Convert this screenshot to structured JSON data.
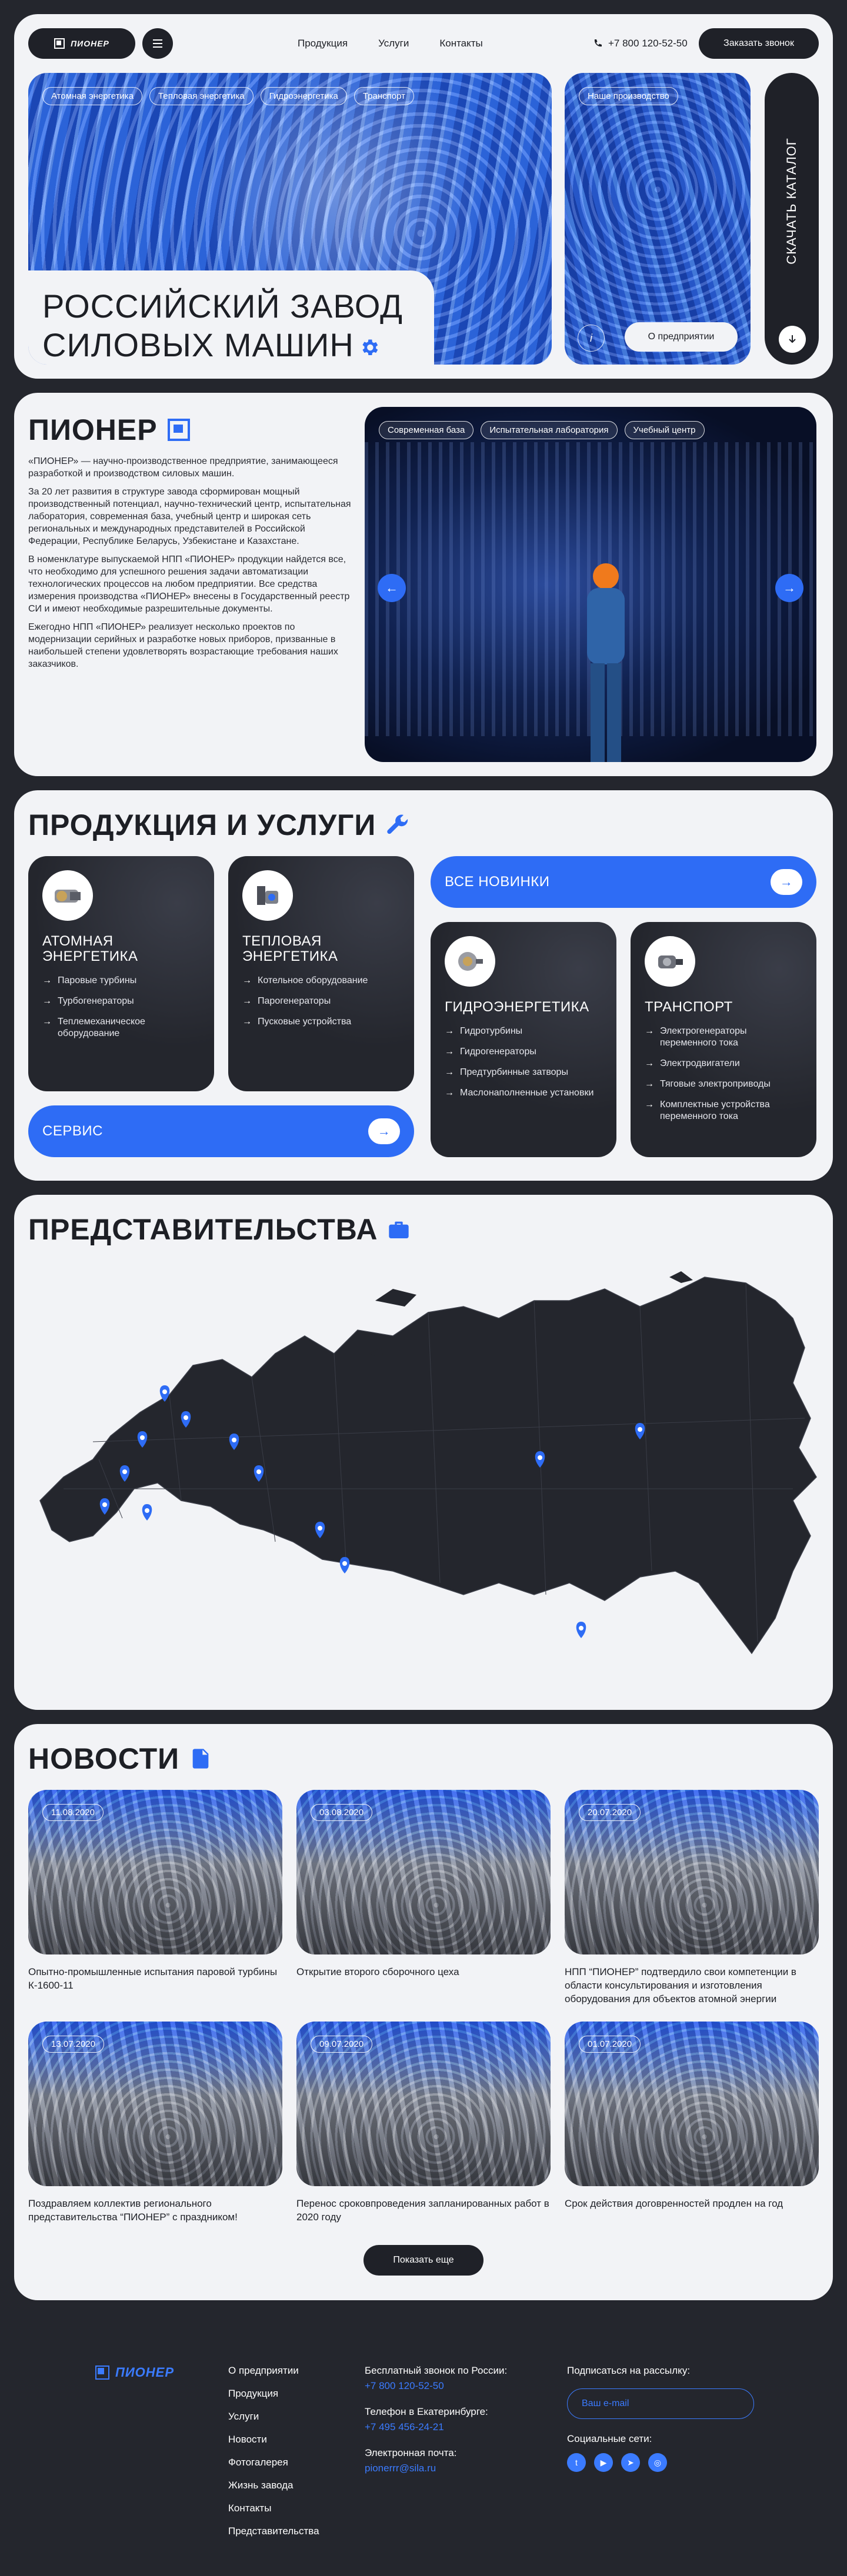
{
  "header": {
    "logo": "ПИОНЕР",
    "nav": [
      "Продукция",
      "Услуги",
      "Контакты"
    ],
    "phone": "+7 800 120-52-50",
    "call_button": "Заказать звонок"
  },
  "hero": {
    "tags": [
      "Атомная энергетика",
      "Тепловая энергетика",
      "Гидроэнергетика",
      "Транспорт"
    ],
    "title": "РОССИЙСКИЙ ЗАВОД\nСИЛОВЫХ МАШИН",
    "side_tag": "Наше производство",
    "about_button": "О предприятии",
    "catalog_button": "СКАЧАТЬ КАТАЛОГ",
    "info_icon": "i"
  },
  "about": {
    "title": "ПИОНЕР",
    "paragraphs": [
      "«ПИОНЕР» — научно-производственное предприятие, занимающееся разработкой и производством силовых машин.",
      "За 20 лет развития в структуре завода сформирован мощный производственный потенциал, научно-технический центр, испытательная лаборатория, современная база, учебный центр и широкая сеть региональных и международных представителей в Российской Федерации, Республике Беларусь, Узбекистане и Казахстане.",
      "В номенклатуре выпускаемой НПП «ПИОНЕР» продукции найдется все, что необходимо для успешного решения задачи автоматизации технологических процессов на любом предприятии. Все средства измерения производства «ПИОНЕР» внесены в Государственный реестр СИ и имеют необходимые разрешительные документы.",
      "Ежегодно НПП «ПИОНЕР» реализует несколько проектов по модернизации серийных и разработке новых приборов, призванные в наибольшей степени удовлетворять возрастающие требования наших заказчиков."
    ],
    "photo_tags": [
      "Современная база",
      "Испытательная лаборатория",
      "Учебный центр"
    ],
    "prev": "←",
    "next": "→"
  },
  "products": {
    "title": "ПРОДУКЦИЯ И УСЛУГИ",
    "all_new": "ВСЕ НОВИНКИ",
    "service": "СЕРВИС",
    "arrow": "→",
    "cards": [
      {
        "title": "АТОМНАЯ\nЭНЕРГЕТИКА",
        "items": [
          "Паровые турбины",
          "Турбогенераторы",
          "Теплемеханическое оборудование"
        ]
      },
      {
        "title": "ТЕПЛОВАЯ\nЭНЕРГЕТИКА",
        "items": [
          "Котельное оборудование",
          "Парогенераторы",
          "Пусковые устройства"
        ]
      },
      {
        "title": "ГИДРОЭНЕРГЕТИКА",
        "items": [
          "Гидротурбины",
          "Гидрогенераторы",
          "Предтурбинные затворы",
          "Маслонаполненные установки"
        ]
      },
      {
        "title": "ТРАНСПОРТ",
        "items": [
          "Электрогенераторы переменного тока",
          "Электродвигатели",
          "Тяговые электроприводы",
          "Комплектные устройства переменного тока"
        ]
      }
    ]
  },
  "map": {
    "title": "ПРЕДСТАВИТЕЛЬСТВА",
    "map_color": "#24262d",
    "pin_color": "#2e6cf5"
  },
  "news": {
    "title": "НОВОСТИ",
    "items": [
      {
        "date": "11.08.2020",
        "title": "Опытно-промышленные испытания паровой турбины К-1600-11"
      },
      {
        "date": "03.08.2020",
        "title": "Открытие второго сборочного цеха"
      },
      {
        "date": "20.07.2020",
        "title": "НПП “ПИОНЕР” подтвердило свои компетенции в области консультирования и изготовления оборудования для объектов атомной энергии"
      },
      {
        "date": "13.07.2020",
        "title": "Поздравляем коллектив регионального представительства “ПИОНЕР” с праздником!"
      },
      {
        "date": "09.07.2020",
        "title": "Перенос сроковпроведения запланированных работ в 2020 году"
      },
      {
        "date": "01.07.2020",
        "title": "Срок действия договренностей продлен на год"
      }
    ],
    "more_button": "Показать еще"
  },
  "footer": {
    "logo": "ПИОНЕР",
    "menu": [
      "О предприятии",
      "Продукция",
      "Услуги",
      "Новости",
      "Фотогалерея",
      "Жизнь завода",
      "Контакты",
      "Представительства"
    ],
    "free_call_label": "Бесплатный звонок по России:",
    "free_call": "+7 800 120-52-50",
    "ekb_label": "Телефон в Екатеринбурге:",
    "ekb_phone": "+7 495 456-24-21",
    "email_label": "Электронная почта:",
    "email": "pionerrr@sila.ru",
    "subscribe_label": "Подписаться на рассылку:",
    "email_placeholder": "Ваш e-mail",
    "social_label": "Социальные сети:",
    "social": [
      "twitter-icon",
      "youtube-icon",
      "telegram-icon",
      "instagram-icon"
    ]
  },
  "colors": {
    "accent": "#2e6cf5",
    "dark": "#1f2128",
    "light": "#f2f3f6"
  }
}
